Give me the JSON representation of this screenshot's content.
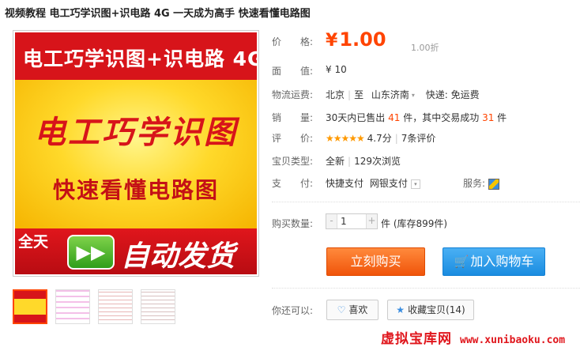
{
  "title": "视频教程 电工巧学识图+识电路 4G 一天成为高手 快速看懂电路图",
  "image": {
    "banner_top": "电工巧学识图+识电路 4G",
    "big_text": "电工巧学识图",
    "sub_text": "快速看懂电路图",
    "quantian": "全天",
    "play_glyph": "▶▶",
    "autoship": "自动发货"
  },
  "props": {
    "price_label": "价　　格:",
    "currency": "¥",
    "price": "1.00",
    "discount": "1.00折",
    "face_label": "面　　值:",
    "face_value": "¥ 10",
    "shipping_label": "物流运费:",
    "from": "北京",
    "to_prefix": "至",
    "to": "山东济南",
    "express": "快递: 免运费",
    "sales_label": "销　　量:",
    "sales_prefix": "30天内已售出",
    "sales_count": "41",
    "sales_mid": "件，其中交易成功",
    "sales_success": "31",
    "sales_suffix": "件",
    "rating_label": "评　　价:",
    "stars": "★★★★★",
    "rating_score": "4.7分",
    "reviews": "7条评价",
    "type_label": "宝贝类型:",
    "condition": "全新",
    "views": "129次浏览",
    "payment_label": "支　　付:",
    "payment_fast": "快捷支付",
    "payment_bank": "网银支付",
    "service_label": "服务:",
    "qty_label": "购买数量:",
    "qty_minus": "-",
    "qty_value": "1",
    "qty_plus": "+",
    "stock": "件 (库存899件)",
    "buy_now": "立刻购买",
    "add_cart": "加入购物车",
    "also_label": "你还可以:",
    "like": "喜欢",
    "favorite": "收藏宝贝(14)"
  },
  "watermark": {
    "cn": "虚拟宝库网",
    "url": "www.xunibaoku.com"
  },
  "colors": {
    "accent_orange": "#ff4400",
    "buy_button": "#f0540a",
    "cart_button": "#1a8ce0",
    "watermark": "#e0161c"
  },
  "icons": [
    "cart-icon",
    "heart-icon",
    "star-icon",
    "service-icon",
    "dropdown-caret-icon",
    "play-icon"
  ]
}
